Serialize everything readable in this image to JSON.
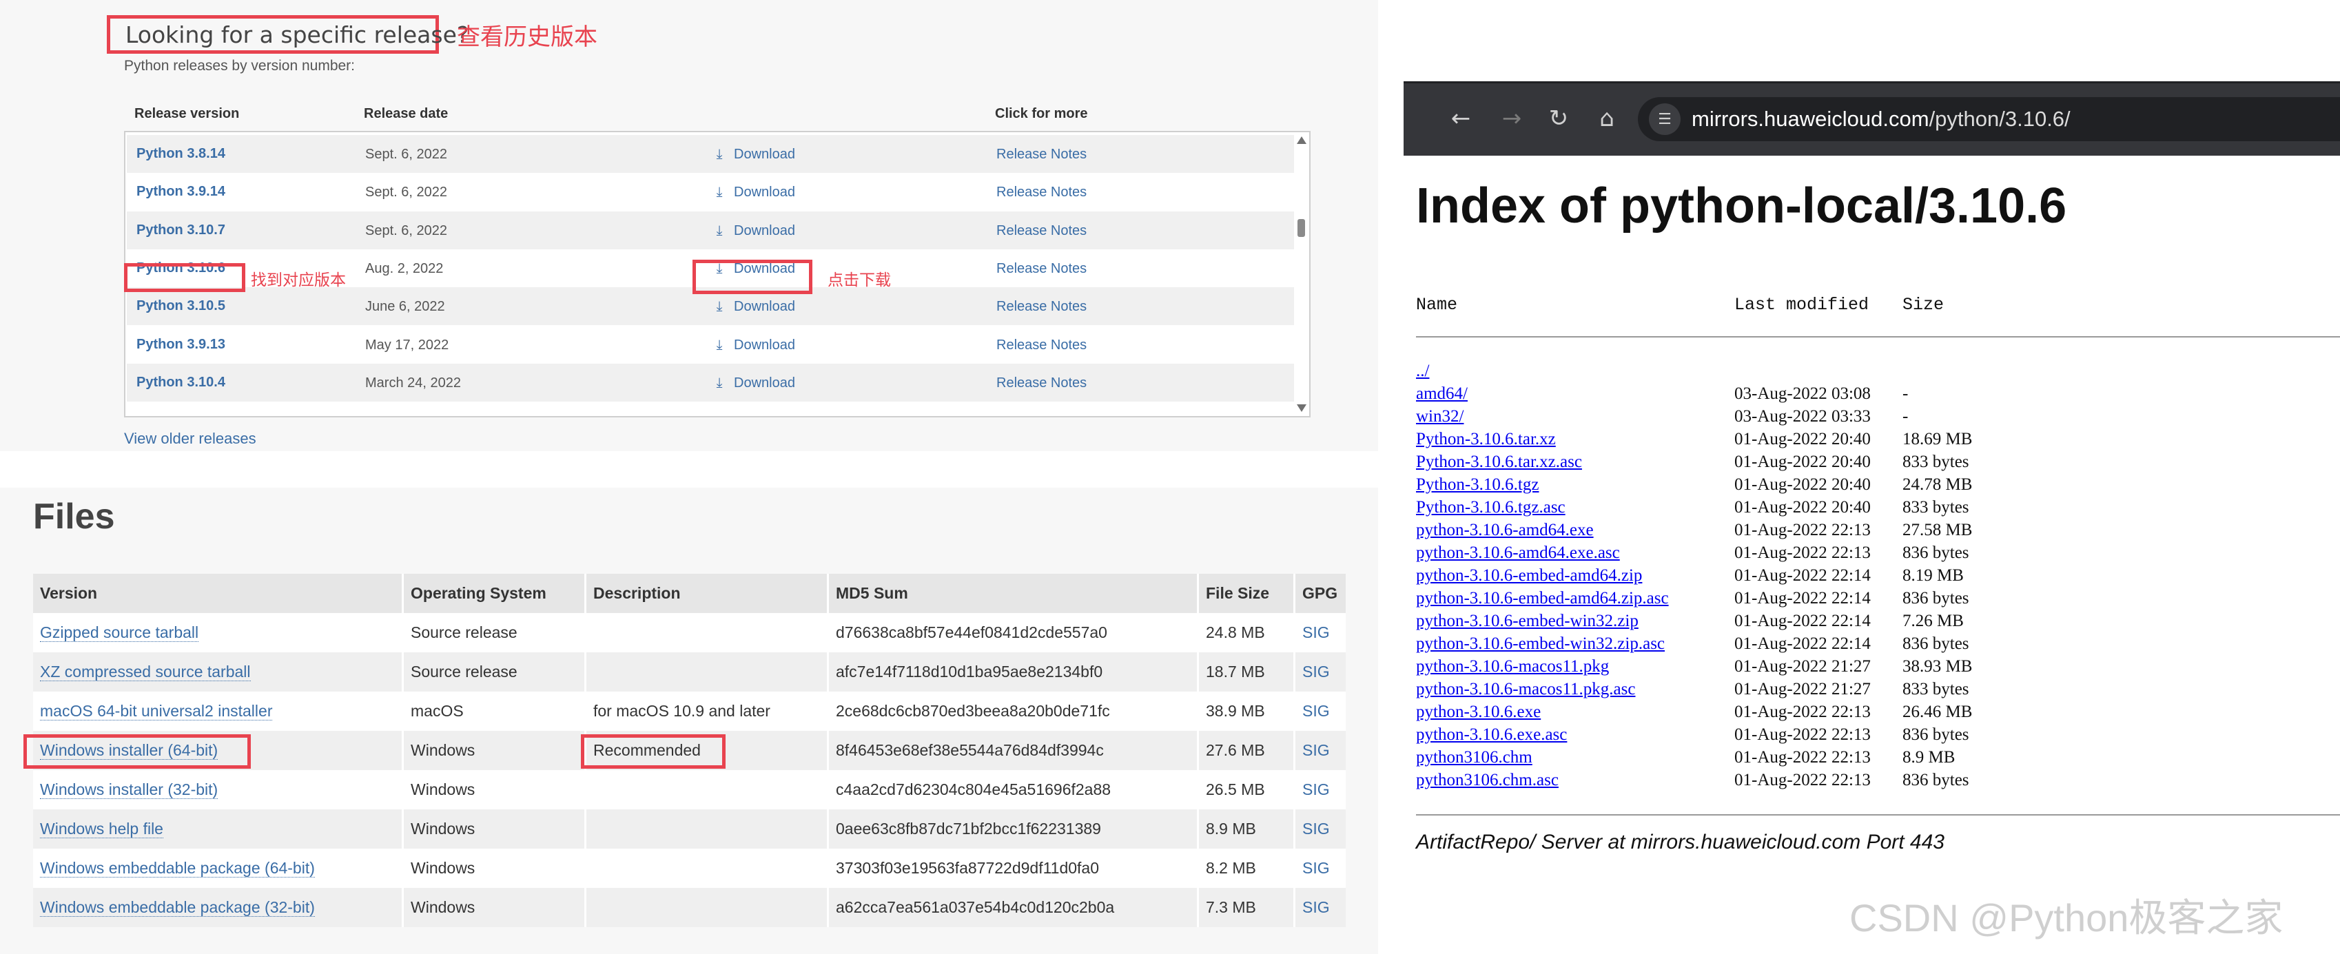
{
  "releases": {
    "heading": "Looking for a specific release?",
    "heading_annotation": "查看历史版本",
    "subtitle": "Python releases by version number:",
    "headers": {
      "version": "Release version",
      "date": "Release date",
      "more": "Click for more"
    },
    "rows": [
      {
        "version": "Python 3.8.14",
        "date": "Sept. 6, 2022",
        "download": "Download",
        "notes": "Release Notes"
      },
      {
        "version": "Python 3.9.14",
        "date": "Sept. 6, 2022",
        "download": "Download",
        "notes": "Release Notes"
      },
      {
        "version": "Python 3.10.7",
        "date": "Sept. 6, 2022",
        "download": "Download",
        "notes": "Release Notes"
      },
      {
        "version": "Python 3.10.6",
        "date": "Aug. 2, 2022",
        "download": "Download",
        "notes": "Release Notes"
      },
      {
        "version": "Python 3.10.5",
        "date": "June 6, 2022",
        "download": "Download",
        "notes": "Release Notes"
      },
      {
        "version": "Python 3.9.13",
        "date": "May 17, 2022",
        "download": "Download",
        "notes": "Release Notes"
      },
      {
        "version": "Python 3.10.4",
        "date": "March 24, 2022",
        "download": "Download",
        "notes": "Release Notes"
      }
    ],
    "find_annotation": "找到对应版本",
    "click_annotation": "点击下载",
    "older_link": "View older releases",
    "download_icon": "download-arrow-icon"
  },
  "files": {
    "title": "Files",
    "headers": {
      "version": "Version",
      "os": "Operating System",
      "description": "Description",
      "md5": "MD5 Sum",
      "size": "File Size",
      "gpg": "GPG"
    },
    "rows": [
      {
        "version": "Gzipped source tarball",
        "os": "Source release",
        "description": "",
        "md5": "d76638ca8bf57e44ef0841d2cde557a0",
        "size": "24.8 MB",
        "gpg": "SIG"
      },
      {
        "version": "XZ compressed source tarball",
        "os": "Source release",
        "description": "",
        "md5": "afc7e14f7118d10d1ba95ae8e2134bf0",
        "size": "18.7 MB",
        "gpg": "SIG"
      },
      {
        "version": "macOS 64-bit universal2 installer",
        "os": "macOS",
        "description": "for macOS 10.9 and later",
        "md5": "2ce68dc6cb870ed3beea8a20b0de71fc",
        "size": "38.9 MB",
        "gpg": "SIG"
      },
      {
        "version": "Windows installer (64-bit)",
        "os": "Windows",
        "description": "Recommended",
        "md5": "8f46453e68ef38e5544a76d84df3994c",
        "size": "27.6 MB",
        "gpg": "SIG"
      },
      {
        "version": "Windows installer (32-bit)",
        "os": "Windows",
        "description": "",
        "md5": "c4aa2cd7d62304c804e45a51696f2a88",
        "size": "26.5 MB",
        "gpg": "SIG"
      },
      {
        "version": "Windows help file",
        "os": "Windows",
        "description": "",
        "md5": "0aee63c8fb87dc71bf2bcc1f62231389",
        "size": "8.9 MB",
        "gpg": "SIG"
      },
      {
        "version": "Windows embeddable package (64-bit)",
        "os": "Windows",
        "description": "",
        "md5": "37303f03e19563fa87722d9df11d0fa0",
        "size": "8.2 MB",
        "gpg": "SIG"
      },
      {
        "version": "Windows embeddable package (32-bit)",
        "os": "Windows",
        "description": "",
        "md5": "a62cca7ea561a037e54b4c0d120c2b0a",
        "size": "7.3 MB",
        "gpg": "SIG"
      }
    ]
  },
  "browser": {
    "url_host": "mirrors.huaweicloud.com",
    "url_path": "/python/3.10.6/",
    "icons": {
      "back": "back-arrow-icon",
      "forward": "forward-arrow-icon",
      "reload": "reload-icon",
      "home": "home-icon",
      "site_info": "site-info-icon"
    }
  },
  "index": {
    "title": "Index of python-local/3.10.6",
    "headers": {
      "name": "Name",
      "modified": "Last modified",
      "size": "Size"
    },
    "entries": [
      {
        "name": "../",
        "date": "",
        "size": ""
      },
      {
        "name": "amd64/",
        "date": "03-Aug-2022 03:08",
        "size": "-"
      },
      {
        "name": "win32/",
        "date": "03-Aug-2022 03:33",
        "size": "-"
      },
      {
        "name": "Python-3.10.6.tar.xz",
        "date": "01-Aug-2022 20:40",
        "size": "18.69 MB"
      },
      {
        "name": "Python-3.10.6.tar.xz.asc",
        "date": "01-Aug-2022 20:40",
        "size": "833 bytes"
      },
      {
        "name": "Python-3.10.6.tgz",
        "date": "01-Aug-2022 20:40",
        "size": "24.78 MB"
      },
      {
        "name": "Python-3.10.6.tgz.asc",
        "date": "01-Aug-2022 20:40",
        "size": "833 bytes"
      },
      {
        "name": "python-3.10.6-amd64.exe",
        "date": "01-Aug-2022 22:13",
        "size": "27.58 MB"
      },
      {
        "name": "python-3.10.6-amd64.exe.asc",
        "date": "01-Aug-2022 22:13",
        "size": "836 bytes"
      },
      {
        "name": "python-3.10.6-embed-amd64.zip",
        "date": "01-Aug-2022 22:14",
        "size": "8.19 MB"
      },
      {
        "name": "python-3.10.6-embed-amd64.zip.asc",
        "date": "01-Aug-2022 22:14",
        "size": "836 bytes"
      },
      {
        "name": "python-3.10.6-embed-win32.zip",
        "date": "01-Aug-2022 22:14",
        "size": "7.26 MB"
      },
      {
        "name": "python-3.10.6-embed-win32.zip.asc",
        "date": "01-Aug-2022 22:14",
        "size": "836 bytes"
      },
      {
        "name": "python-3.10.6-macos11.pkg",
        "date": "01-Aug-2022 21:27",
        "size": "38.93 MB"
      },
      {
        "name": "python-3.10.6-macos11.pkg.asc",
        "date": "01-Aug-2022 21:27",
        "size": "833 bytes"
      },
      {
        "name": "python-3.10.6.exe",
        "date": "01-Aug-2022 22:13",
        "size": "26.46 MB"
      },
      {
        "name": "python-3.10.6.exe.asc",
        "date": "01-Aug-2022 22:13",
        "size": "836 bytes"
      },
      {
        "name": "python3106.chm",
        "date": "01-Aug-2022 22:13",
        "size": "8.9 MB"
      },
      {
        "name": "python3106.chm.asc",
        "date": "01-Aug-2022 22:13",
        "size": "836 bytes"
      }
    ],
    "server_line": "ArtifactRepo/ Server at mirrors.huaweicloud.com Port 443"
  },
  "watermark": "CSDN @Python极客之家",
  "colors": {
    "annotation_red": "#e8434f",
    "link_blue": "#3a6da6",
    "dir_link": "#0000ee",
    "browser_chrome": "#35363a"
  }
}
